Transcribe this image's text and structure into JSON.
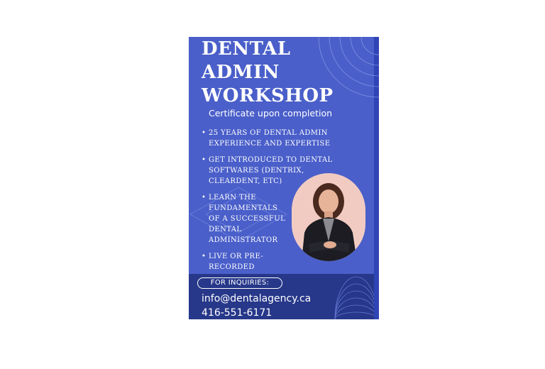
{
  "poster": {
    "title_lines": [
      "DENTAL",
      "ADMIN",
      "WORKSHOP"
    ],
    "subtitle": "Certificate upon completion",
    "bullets": [
      "25 YEARS OF DENTAL ADMIN EXPERIENCE AND EXPERTISE",
      "GET INTRODUCED TO DENTAL SOFTWARES (DENTRIX, CLEARDENT, ETC)",
      "LEARN THE FUNDAMENTALS OF A SUCCESSFUL DENTAL ADMINISTRATOR",
      "LIVE OR PRE-RECORDED OPTIONS"
    ],
    "inquiries_label": "FOR INQUIRIES:",
    "email": "info@dentalagency.ca",
    "phone": "416-551-6171",
    "colors": {
      "background": "#4a5fc9",
      "footer": "#27388a",
      "photo_background": "#f1cbc2",
      "text": "#ffffff"
    },
    "icons": [
      "concentric-arcs-icon",
      "diamond-outline-icon",
      "portrait-photo"
    ]
  }
}
